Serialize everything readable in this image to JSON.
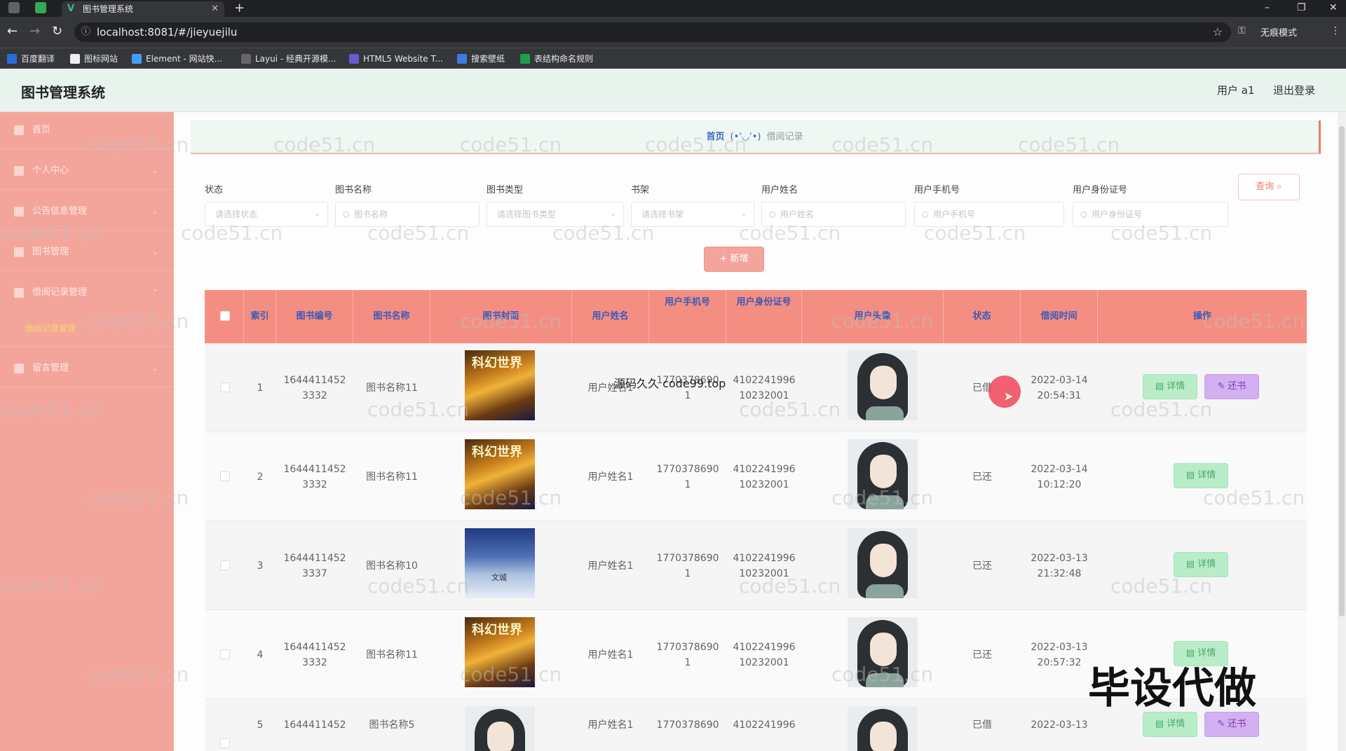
{
  "browser": {
    "tab_title": "图书管理系统",
    "tab_close": "✕",
    "new_tab": "+",
    "url": "localhost:8081/#/jieyuejilu",
    "incognito": "无痕模式",
    "window_controls": [
      "–",
      "❐",
      "✕"
    ],
    "bookmarks": [
      "百度翻译",
      "图标网站",
      "Element - 网站快...",
      "Layui - 经典开源模...",
      "HTML5 Website T...",
      "搜索壁纸",
      "表结构命名规则"
    ]
  },
  "header": {
    "title": "图书管理系统",
    "user": "用户 a1",
    "logout": "退出登录"
  },
  "sidebar": {
    "items": [
      {
        "label": "首页",
        "chevron": ""
      },
      {
        "label": "个人中心",
        "chevron": "⌄"
      },
      {
        "label": "公告信息管理",
        "chevron": "⌄"
      },
      {
        "label": "图书管理",
        "chevron": "⌄"
      },
      {
        "label": "借阅记录管理",
        "chevron": "⌃"
      },
      {
        "label": "留言管理",
        "chevron": "⌄"
      }
    ],
    "sub_item": "借阅记录管理"
  },
  "breadcrumb": {
    "home": "首页",
    "face": "(•'◡'•)",
    "current": "借阅记录"
  },
  "filters": {
    "status": {
      "label": "状态",
      "placeholder": "请选择状态"
    },
    "book_name": {
      "label": "图书名称",
      "placeholder": "图书名称"
    },
    "book_type": {
      "label": "图书类型",
      "placeholder": "请选择图书类型"
    },
    "shelf": {
      "label": "书架",
      "placeholder": "请选择书架"
    },
    "user_name": {
      "label": "用户姓名",
      "placeholder": "用户姓名"
    },
    "user_phone": {
      "label": "用户手机号",
      "placeholder": "用户手机号"
    },
    "user_id": {
      "label": "用户身份证号",
      "placeholder": "用户身份证号"
    },
    "query_button": "查询 ⌕",
    "add_button": "+ 新增"
  },
  "table": {
    "columns": [
      "索引",
      "图书编号",
      "图书名称",
      "图书封面",
      "用户姓名",
      "用户手机号",
      "用户身份证号",
      "用户头像",
      "状态",
      "借阅时间",
      "操作"
    ],
    "detail_label": "▤ 详情",
    "return_label": "✎ 还书",
    "rows": [
      {
        "index": "1",
        "book_no_1": "1644411452",
        "book_no_2": "3332",
        "book_name": "图书名称11",
        "cover": "科幻世界",
        "user_name": "用户姓名1",
        "phone_1": "1770378690",
        "phone_2": "1",
        "idno_1": "4102241996",
        "idno_2": "10232001",
        "status": "已借",
        "date": "2022-03-14",
        "time": "20:54:31",
        "returnable": true
      },
      {
        "index": "2",
        "book_no_1": "1644411452",
        "book_no_2": "3332",
        "book_name": "图书名称11",
        "cover": "科幻世界",
        "user_name": "用户姓名1",
        "phone_1": "1770378690",
        "phone_2": "1",
        "idno_1": "4102241996",
        "idno_2": "10232001",
        "status": "已还",
        "date": "2022-03-14",
        "time": "10:12:20",
        "returnable": false
      },
      {
        "index": "3",
        "book_no_1": "1644411452",
        "book_no_2": "3337",
        "book_name": "图书名称10",
        "cover": "文城",
        "user_name": "用户姓名1",
        "phone_1": "1770378690",
        "phone_2": "1",
        "idno_1": "4102241996",
        "idno_2": "10232001",
        "status": "已还",
        "date": "2022-03-13",
        "time": "21:32:48",
        "returnable": false
      },
      {
        "index": "4",
        "book_no_1": "1644411452",
        "book_no_2": "3332",
        "book_name": "图书名称11",
        "cover": "科幻世界",
        "user_name": "用户姓名1",
        "phone_1": "1770378690",
        "phone_2": "1",
        "idno_1": "4102241996",
        "idno_2": "10232001",
        "status": "已还",
        "date": "2022-03-13",
        "time": "20:57:32",
        "returnable": false
      },
      {
        "index": "5",
        "book_no_1": "1644411452",
        "book_no_2": "",
        "book_name": "图书名称5",
        "cover": "",
        "user_name": "用户姓名1",
        "phone_1": "1770378690",
        "phone_2": "",
        "idno_1": "4102241996",
        "idno_2": "",
        "status": "已借",
        "date": "2022-03-13",
        "time": "",
        "returnable": true
      }
    ]
  },
  "overlays": {
    "source_text": "源码久久 code99.top",
    "banner": "毕设代做",
    "watermark": "code51.cn"
  }
}
